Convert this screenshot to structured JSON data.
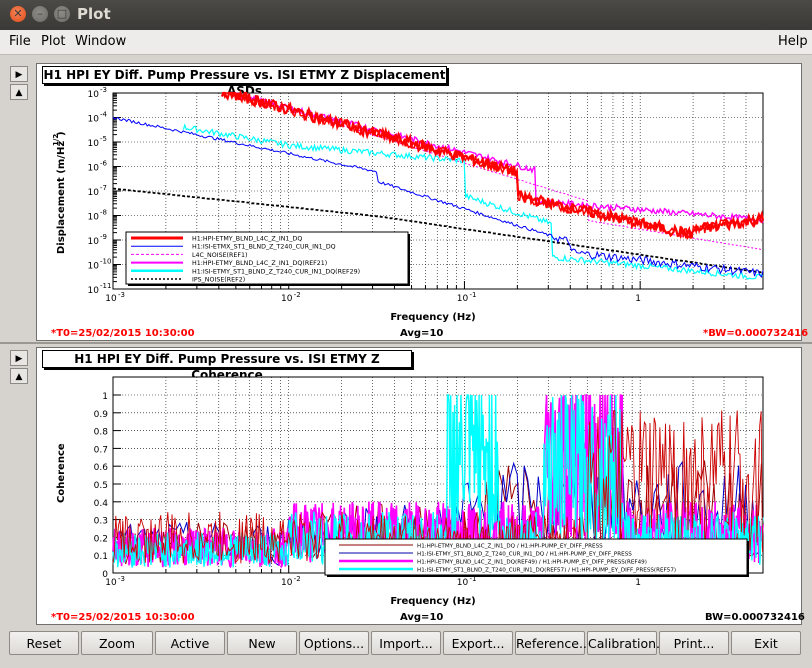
{
  "window": {
    "title": "Plot"
  },
  "menu": {
    "file": "File",
    "plot": "Plot",
    "window": "Window",
    "help": "Help"
  },
  "asd": {
    "title": "H1 HPI EY Diff. Pump Pressure vs. ISI ETMY Z Displacement ASDs",
    "ylabel": "Displacement (m/Hz",
    "ylabel_exp": "1/2",
    "ylabel_close": ")",
    "xlabel": "Frequency (Hz)",
    "t0": "*T0=25/02/2015 10:30:00",
    "avg": "Avg=10",
    "bw": "*BW=0.000732416",
    "yticks": [
      "10",
      "10",
      "10",
      "10",
      "10",
      "10",
      "10",
      "10",
      "10"
    ],
    "yexp": [
      "-3",
      "-4",
      "-5",
      "-6",
      "-7",
      "-8",
      "-9",
      "-10",
      "-11"
    ],
    "xticks": [
      "10",
      "10",
      "10",
      "1"
    ],
    "xexp": [
      "-3",
      "-2",
      "-1",
      ""
    ],
    "legend": [
      {
        "label": "H1:HPI-ETMY_BLND_L4C_Z_IN1_DQ",
        "color": "#ff0000"
      },
      {
        "label": "H1:ISI-ETMX_ST1_BLND_Z_T240_CUR_IN1_DQ",
        "color": "#0000ff"
      },
      {
        "label": "L4C_NOISE(REF1)",
        "color": "#ff00ff"
      },
      {
        "label": "H1:HPI-ETMY_BLND_L4C_Z_IN1_DQ(REF21)",
        "color": "#ff00ff"
      },
      {
        "label": "H1:ISI-ETMY_ST1_BLND_Z_T240_CUR_IN1_DQ(REF29)",
        "color": "#00ffff"
      },
      {
        "label": "IPS_NOISE(REF2)",
        "color": "#000000"
      }
    ]
  },
  "coh": {
    "title": "H1 HPI EY Diff. Pump Pressure vs. ISI ETMY Z Coherence",
    "ylabel": "Coherence",
    "xlabel": "Frequency (Hz)",
    "t0": "*T0=25/02/2015 10:30:00",
    "avg": "Avg=10",
    "bw": "BW=0.000732416",
    "yticks": [
      "0",
      "0.1",
      "0.2",
      "0.3",
      "0.4",
      "0.5",
      "0.6",
      "0.7",
      "0.8",
      "0.9",
      "1"
    ],
    "xticks": [
      "10",
      "10",
      "10",
      "1"
    ],
    "xexp": [
      "-3",
      "-2",
      "-1",
      ""
    ],
    "legend": [
      {
        "label": "H1:HPI-ETMY_BLND_L4C_Z_IN1_DQ / H1:HPI-PUMP_EY_DIFF_PRESS",
        "color": "#8b0000"
      },
      {
        "label": "H1:ISI-ETMY_ST1_BLND_Z_T240_CUR_IN1_DQ / H1:HPI-PUMP_EY_DIFF_PRESS",
        "color": "#0000aa"
      },
      {
        "label": "H1:HPI-ETMY_BLND_L4C_Z_IN1_DQ(REF49) / H1:HPI-PUMP_EY_DIFF_PRESS(REF49)",
        "color": "#ff00ff"
      },
      {
        "label": "H1:ISI-ETMY_ST1_BLND_Z_T240_CUR_IN1_DQ(REF57) / H1:HPI-PUMP_EY_DIFF_PRESS(REF57)",
        "color": "#00ffff"
      }
    ]
  },
  "buttons": [
    "Reset",
    "Zoom",
    "Active",
    "New",
    "Options...",
    "Import...",
    "Export...",
    "Reference...",
    "Calibration...",
    "Print...",
    "Exit"
  ]
}
